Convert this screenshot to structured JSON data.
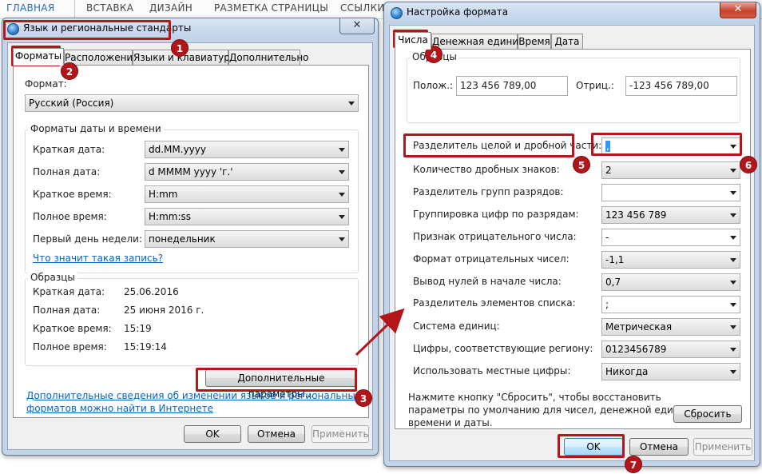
{
  "ribbon": {
    "tabs": [
      "ГЛАВНАЯ",
      "ВСТАВКА",
      "ДИЗАЙН",
      "РАЗМЕТКА СТРАНИЦЫ",
      "ССЫЛКИ"
    ]
  },
  "left_window": {
    "title": "Язык и региональные стандарты",
    "close": "✕",
    "tabs": [
      "Форматы",
      "Расположение",
      "Языки и клавиатуры",
      "Дополнительно"
    ],
    "format_label": "Формат:",
    "format_value": "Русский (Россия)",
    "datetime_group": "Форматы даты и времени",
    "rows": [
      {
        "label": "Краткая дата:",
        "value": "dd.MM.yyyy"
      },
      {
        "label": "Полная дата:",
        "value": "d MMMM yyyy 'г.'"
      },
      {
        "label": "Краткое время:",
        "value": "H:mm"
      },
      {
        "label": "Полное время:",
        "value": "H:mm:ss"
      },
      {
        "label": "Первый день недели:",
        "value": "понедельник"
      }
    ],
    "what_link": "Что значит такая запись?",
    "samples_group": "Образцы",
    "samples": [
      {
        "label": "Краткая дата:",
        "value": "25.06.2016"
      },
      {
        "label": "Полная дата:",
        "value": "25 июня 2016 г."
      },
      {
        "label": "Краткое время:",
        "value": "15:19"
      },
      {
        "label": "Полное время:",
        "value": "15:19:14"
      }
    ],
    "advanced_button": "Дополнительные параметры...",
    "info_link_1": "Дополнительные сведения об изменении языков и региональных",
    "info_link_2": "форматов можно найти в Интернете",
    "ok": "OK",
    "cancel": "Отмена",
    "apply": "Применить"
  },
  "right_window": {
    "title": "Настройка формата",
    "close": "✕",
    "tabs": [
      "Числа",
      "Денежная единица",
      "Время",
      "Дата"
    ],
    "samples_group": "Образцы",
    "positive_label": "Полож.:",
    "positive_value": "123 456 789,00",
    "negative_label": "Отриц.:",
    "negative_value": "-123 456 789,00",
    "settings": [
      {
        "label": "Разделитель целой и дробной части:",
        "value": ","
      },
      {
        "label": "Количество дробных знаков:",
        "value": "2"
      },
      {
        "label": "Разделитель групп разрядов:",
        "value": ""
      },
      {
        "label": "Группировка цифр по разрядам:",
        "value": "123 456 789"
      },
      {
        "label": "Признак отрицательного числа:",
        "value": "-"
      },
      {
        "label": "Формат отрицательных чисел:",
        "value": "-1,1"
      },
      {
        "label": "Вывод нулей в начале числа:",
        "value": "0,7"
      },
      {
        "label": "Разделитель элементов списка:",
        "value": ";"
      },
      {
        "label": "Система единиц:",
        "value": "Метрическая"
      },
      {
        "label": "Цифры, соответствующие региону:",
        "value": "0123456789"
      },
      {
        "label": "Использовать местные цифры:",
        "value": "Никогда"
      }
    ],
    "reset_text_1": "Нажмите кнопку \"Сбросить\", чтобы восстановить",
    "reset_text_2": "параметры по умолчанию для чисел, денежной единицы,",
    "reset_text_3": "времени и даты.",
    "reset_button": "Сбросить",
    "ok": "OK",
    "cancel": "Отмена",
    "apply": "Применить"
  },
  "badges": [
    "1",
    "2",
    "3",
    "4",
    "5",
    "6",
    "7"
  ],
  "colors": {
    "annotation": "#b3161a",
    "link": "#0066cc",
    "ribbon_active": "#2a6bb5"
  }
}
